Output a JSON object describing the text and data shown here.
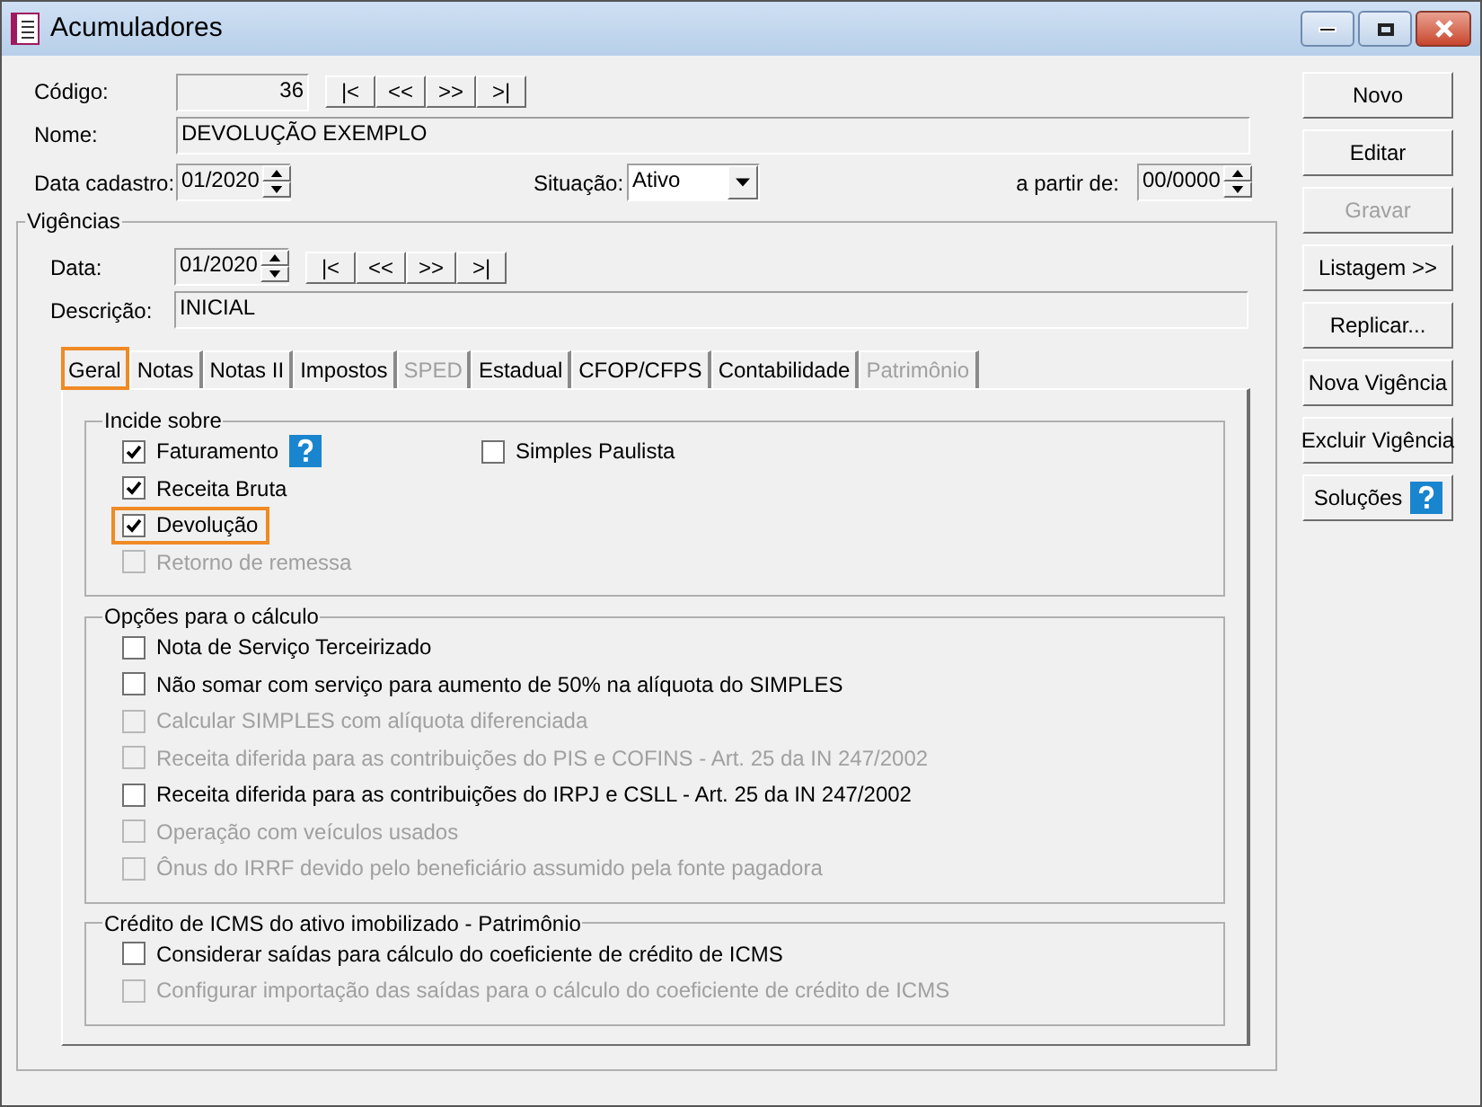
{
  "window": {
    "title": "Acumuladores"
  },
  "codigo": {
    "label": "Código:",
    "value": "36",
    "nav_buttons": [
      "|<",
      "<<",
      ">>",
      ">|"
    ]
  },
  "nome": {
    "label": "Nome:",
    "value": "DEVOLUÇÃO EXEMPLO"
  },
  "data_cadastro": {
    "label": "Data cadastro:",
    "value": "01/2020"
  },
  "situacao": {
    "label": "Situação:",
    "value": "Ativo"
  },
  "a_partir_de": {
    "label": "a partir de:",
    "value": "00/0000"
  },
  "vigencias": {
    "title": "Vigências",
    "data": {
      "label": "Data:",
      "value": "01/2020",
      "nav_buttons": [
        "|<",
        "<<",
        ">>",
        ">|"
      ]
    },
    "descricao": {
      "label": "Descrição:",
      "value": "INICIAL"
    },
    "tabs": [
      {
        "label": "Geral",
        "selected": true,
        "disabled": false,
        "highlighted": true
      },
      {
        "label": "Notas",
        "selected": false,
        "disabled": false,
        "highlighted": false
      },
      {
        "label": "Notas II",
        "selected": false,
        "disabled": false,
        "highlighted": false
      },
      {
        "label": "Impostos",
        "selected": false,
        "disabled": false,
        "highlighted": false
      },
      {
        "label": "SPED",
        "selected": false,
        "disabled": true,
        "highlighted": false
      },
      {
        "label": "Estadual",
        "selected": false,
        "disabled": false,
        "highlighted": false
      },
      {
        "label": "CFOP/CFPS",
        "selected": false,
        "disabled": false,
        "highlighted": false
      },
      {
        "label": "Contabilidade",
        "selected": false,
        "disabled": false,
        "highlighted": false
      },
      {
        "label": "Patrimônio",
        "selected": false,
        "disabled": true,
        "highlighted": false
      }
    ],
    "groups": [
      {
        "title": "Incide sobre",
        "columns": [
          [
            {
              "label": "Faturamento",
              "checked": true,
              "disabled": false,
              "highlighted": false,
              "help": true
            },
            {
              "label": "Receita Bruta",
              "checked": true,
              "disabled": false,
              "highlighted": false,
              "help": false
            },
            {
              "label": "Devolução",
              "checked": true,
              "disabled": false,
              "highlighted": true,
              "help": false
            },
            {
              "label": "Retorno de remessa",
              "checked": false,
              "disabled": true,
              "highlighted": false,
              "help": false
            }
          ],
          [
            {
              "label": "Simples Paulista",
              "checked": false,
              "disabled": false,
              "highlighted": false,
              "help": false
            }
          ]
        ]
      },
      {
        "title": "Opções para o cálculo",
        "columns": [
          [
            {
              "label": "Nota de Serviço Terceirizado",
              "checked": false,
              "disabled": false,
              "highlighted": false,
              "help": false
            },
            {
              "label": "Não somar com serviço para aumento de 50% na alíquota do SIMPLES",
              "checked": false,
              "disabled": false,
              "highlighted": false,
              "help": false
            },
            {
              "label": "Calcular SIMPLES com alíquota diferenciada",
              "checked": false,
              "disabled": true,
              "highlighted": false,
              "help": false
            },
            {
              "label": "Receita diferida para as contribuições do PIS e COFINS -  Art. 25 da IN 247/2002",
              "checked": false,
              "disabled": true,
              "highlighted": false,
              "help": false
            },
            {
              "label": "Receita diferida para as contribuições do IRPJ e CSLL - Art. 25 da IN 247/2002",
              "checked": false,
              "disabled": false,
              "highlighted": false,
              "help": false
            },
            {
              "label": "Operação com veículos usados",
              "checked": false,
              "disabled": true,
              "highlighted": false,
              "help": false
            },
            {
              "label": "Ônus do IRRF devido pelo beneficiário assumido pela fonte pagadora",
              "checked": false,
              "disabled": true,
              "highlighted": false,
              "help": false
            }
          ]
        ]
      },
      {
        "title": "Crédito de ICMS do ativo imobilizado - Patrimônio",
        "columns": [
          [
            {
              "label": "Considerar saídas para cálculo do coeficiente de crédito de ICMS",
              "checked": false,
              "disabled": false,
              "highlighted": false,
              "help": false
            },
            {
              "label": "Configurar importação das saídas para o cálculo do coeficiente de crédito de ICMS",
              "checked": false,
              "disabled": true,
              "highlighted": false,
              "help": false
            }
          ]
        ]
      }
    ]
  },
  "buttons": [
    {
      "label": "Novo",
      "disabled": false,
      "help": false
    },
    {
      "label": "Editar",
      "disabled": false,
      "help": false
    },
    {
      "label": "Gravar",
      "disabled": true,
      "help": false
    },
    {
      "label": "Listagem >>",
      "disabled": false,
      "help": false
    },
    {
      "label": "Replicar...",
      "disabled": false,
      "help": false
    },
    {
      "label": "Nova Vigência",
      "disabled": false,
      "help": false
    },
    {
      "label": "Excluir Vigência",
      "disabled": false,
      "help": false
    },
    {
      "label": "Soluções",
      "disabled": false,
      "help": true
    }
  ]
}
